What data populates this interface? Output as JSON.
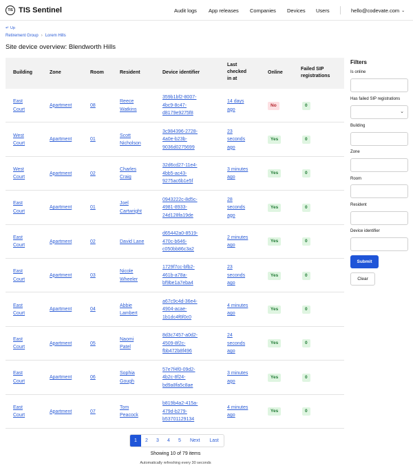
{
  "header": {
    "logo_mark": "TIS",
    "app_name": "TIS Sentinel",
    "nav": [
      "Audit logs",
      "App releases",
      "Companies",
      "Devices",
      "Users"
    ],
    "user_email": "hello@codevate.com"
  },
  "breadcrumbs": {
    "up_label": "Up",
    "items": [
      "Retirement Group",
      "Lorem Hills"
    ]
  },
  "page_title": "Site device overview: Blendworth Hills",
  "table": {
    "headers": {
      "building": "Building",
      "zone": "Zone",
      "room": "Room",
      "resident": "Resident",
      "device": "Device identifier",
      "last_checked": [
        "Last",
        "checked",
        "in at"
      ],
      "online": "Online",
      "failed_sip": [
        "Failed SIP",
        "registrations"
      ]
    },
    "rows": [
      {
        "building": [
          "East",
          "Court"
        ],
        "zone": "Apartment",
        "room": "08",
        "resident": [
          "Reece",
          "Watkins"
        ],
        "device": [
          "359b1bf2-8007-",
          "4bc9-8c47-",
          "d8179e9275f8"
        ],
        "last_checked": [
          "14 days",
          "ago"
        ],
        "online": "No",
        "failed": "0"
      },
      {
        "building": [
          "West",
          "Court"
        ],
        "zone": "Apartment",
        "room": "01",
        "resident": [
          "Scott",
          "Nicholson"
        ],
        "device": [
          "3c984396-2728-",
          "4a0e-b23b-",
          "9036d0275699"
        ],
        "last_checked": [
          "23",
          "seconds",
          "ago"
        ],
        "online": "Yes",
        "failed": "0"
      },
      {
        "building": [
          "West",
          "Court"
        ],
        "zone": "Apartment",
        "room": "02",
        "resident": [
          "Charles",
          "Craig"
        ],
        "device": [
          "32d6cd27-11e4-",
          "4bb5-ac43-",
          "9275ac6b1e5f"
        ],
        "last_checked": [
          "3 minutes",
          "ago"
        ],
        "online": "Yes",
        "failed": "0"
      },
      {
        "building": [
          "East",
          "Court"
        ],
        "zone": "Apartment",
        "room": "01",
        "resident": [
          "Joel",
          "Cartwright"
        ],
        "device": [
          "0943222c-8d5c-",
          "4981-8933-",
          "24d128fa19de"
        ],
        "last_checked": [
          "28",
          "seconds",
          "ago"
        ],
        "online": "Yes",
        "failed": "0"
      },
      {
        "building": [
          "East",
          "Court"
        ],
        "zone": "Apartment",
        "room": "02",
        "resident": [
          "David Lane"
        ],
        "device": [
          "d65442a0-8519-",
          "470c-b646-",
          "c050bb86c3a2"
        ],
        "last_checked": [
          "2 minutes",
          "ago"
        ],
        "online": "Yes",
        "failed": "0"
      },
      {
        "building": [
          "East",
          "Court"
        ],
        "zone": "Apartment",
        "room": "03",
        "resident": [
          "Nicole",
          "Wheeler"
        ],
        "device": [
          "1729f7cc-bfb2-",
          "461b-a78a-",
          "bf9be1a7eba4"
        ],
        "last_checked": [
          "23",
          "seconds",
          "ago"
        ],
        "online": "Yes",
        "failed": "0"
      },
      {
        "building": [
          "East",
          "Court"
        ],
        "zone": "Apartment",
        "room": "04",
        "resident": [
          "Abbie",
          "Lambert"
        ],
        "device": [
          "a67c9c4d-36e4-",
          "4904-acae-",
          "1b1dc4f6f0c0"
        ],
        "last_checked": [
          "4 minutes",
          "ago"
        ],
        "online": "Yes",
        "failed": "0"
      },
      {
        "building": [
          "East",
          "Court"
        ],
        "zone": "Apartment",
        "room": "05",
        "resident": [
          "Naomi",
          "Patel"
        ],
        "device": [
          "8d3c7457-a0d2-",
          "4509-8f2c-",
          "fbb472b8f496"
        ],
        "last_checked": [
          "24",
          "seconds",
          "ago"
        ],
        "online": "Yes",
        "failed": "0"
      },
      {
        "building": [
          "East",
          "Court"
        ],
        "zone": "Apartment",
        "room": "06",
        "resident": [
          "Sophia",
          "Gough"
        ],
        "device": [
          "57e7f4f0-09d2-",
          "4b2c-8f24-",
          "bd9a8fa5c8ae"
        ],
        "last_checked": [
          "3 minutes",
          "ago"
        ],
        "online": "Yes",
        "failed": "0"
      },
      {
        "building": [
          "East",
          "Court"
        ],
        "zone": "Apartment",
        "room": "07",
        "resident": [
          "Tom",
          "Peacock"
        ],
        "device": [
          "b819b4a2-415a-",
          "479d-b279-",
          "b53701129134"
        ],
        "last_checked": [
          "4 minutes",
          "ago"
        ],
        "online": "Yes",
        "failed": "0"
      }
    ]
  },
  "filters": {
    "title": "Filters",
    "fields": [
      {
        "label": "Is online",
        "type": "select",
        "value": ""
      },
      {
        "label": "Has failed SIP registrations",
        "type": "select",
        "value": ""
      },
      {
        "label": "Building",
        "type": "text",
        "value": ""
      },
      {
        "label": "Zone",
        "type": "text",
        "value": ""
      },
      {
        "label": "Room",
        "type": "text",
        "value": ""
      },
      {
        "label": "Resident",
        "type": "text",
        "value": ""
      },
      {
        "label": "Device identifier",
        "type": "text",
        "value": ""
      }
    ],
    "submit_label": "Submit",
    "clear_label": "Clear"
  },
  "pagination": {
    "pages": [
      "1",
      "2",
      "3",
      "4",
      "5"
    ],
    "current": "1",
    "next_label": "Next",
    "last_label": "Last",
    "showing_text": "Showing 10 of 79 items",
    "refresh_text": "Automatically refreshing every 30 seconds"
  },
  "colors": {
    "accent": "#1f55d8",
    "link": "#2b5cd6",
    "online_yes_bg": "#dff5e1",
    "online_no_bg": "#fde0e3"
  }
}
